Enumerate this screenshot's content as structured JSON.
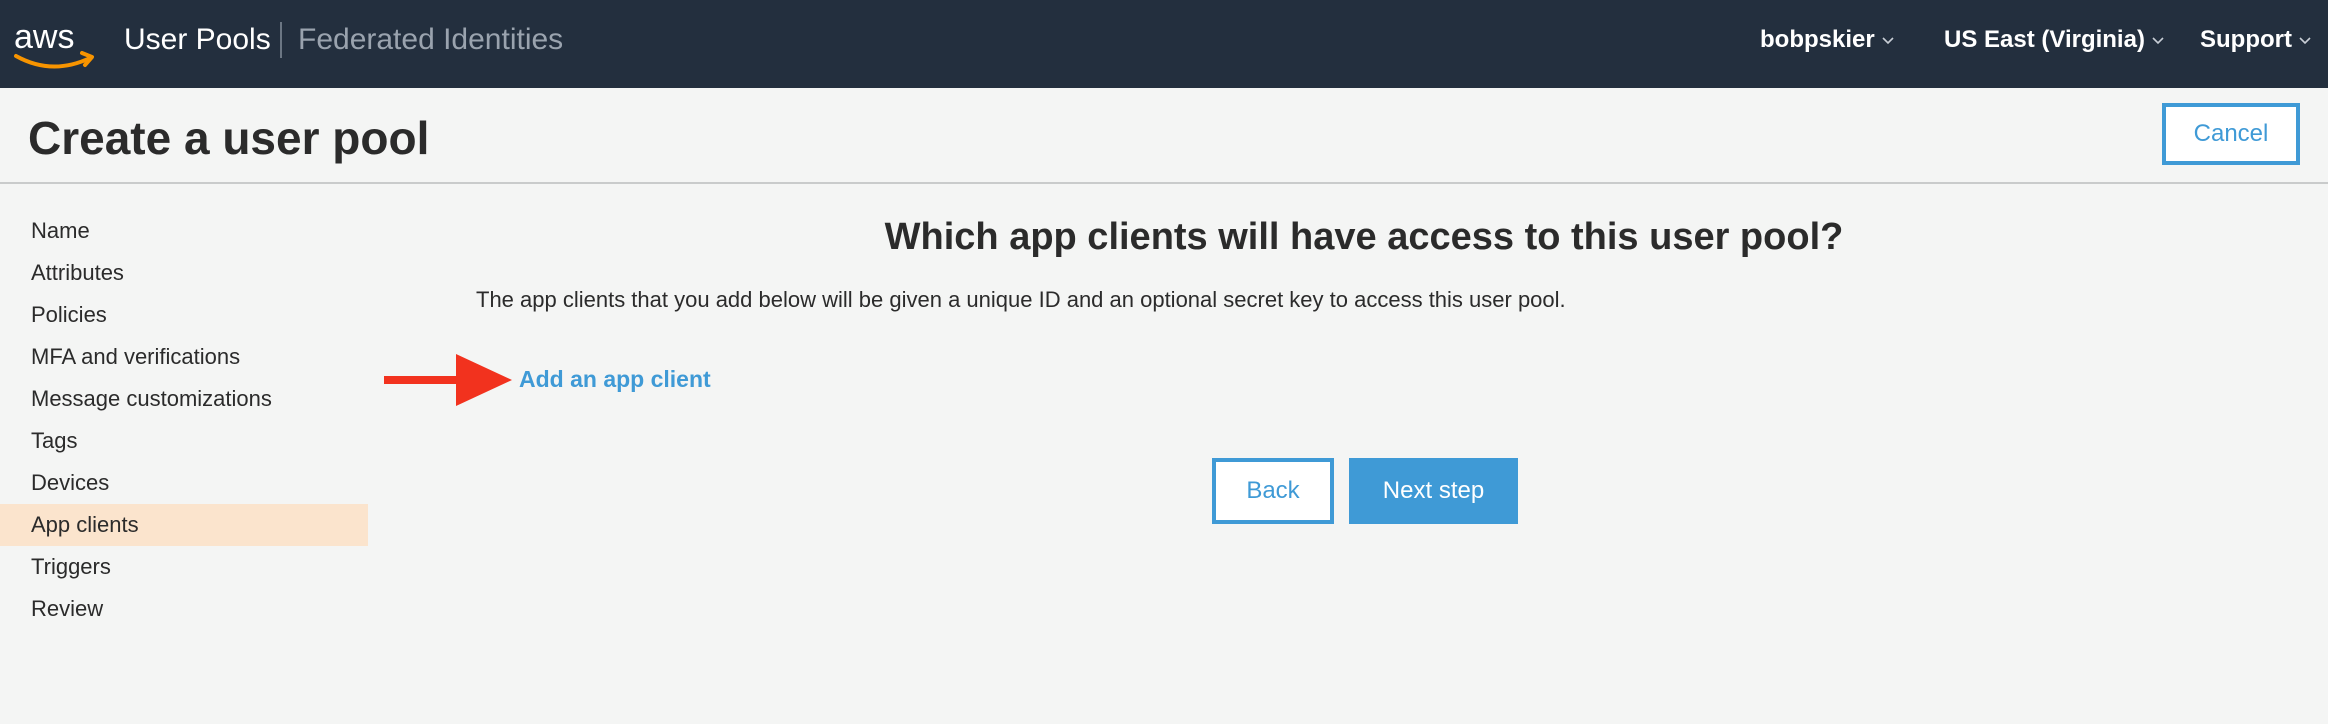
{
  "navbar": {
    "logo_text": "aws",
    "title": "User Pools",
    "secondary_link": "Federated Identities",
    "user_menu": "bobpskier",
    "region_menu": "US East (Virginia)",
    "support_menu": "Support"
  },
  "header": {
    "title": "Create a user pool",
    "cancel_label": "Cancel"
  },
  "sidebar": {
    "items": [
      {
        "label": "Name"
      },
      {
        "label": "Attributes"
      },
      {
        "label": "Policies"
      },
      {
        "label": "MFA and verifications"
      },
      {
        "label": "Message customizations"
      },
      {
        "label": "Tags"
      },
      {
        "label": "Devices"
      },
      {
        "label": "App clients"
      },
      {
        "label": "Triggers"
      },
      {
        "label": "Review"
      }
    ],
    "active_item": "App clients"
  },
  "main": {
    "heading": "Which app clients will have access to this user pool?",
    "description": "The app clients that you add below will be given a unique ID and an optional secret key to access this user pool.",
    "add_link": "Add an app client",
    "back_label": "Back",
    "next_label": "Next step"
  },
  "colors": {
    "navbar_bg": "#232f3e",
    "accent": "#3f9ad6",
    "active_item_bg": "#fbe4cd",
    "arrow": "#f2321e",
    "logo_smile": "#f79400"
  },
  "icons": {
    "logo": "aws-logo-icon",
    "menu_chevron": "chevron-down-icon",
    "annotation_arrow": "red-arrow-icon"
  }
}
